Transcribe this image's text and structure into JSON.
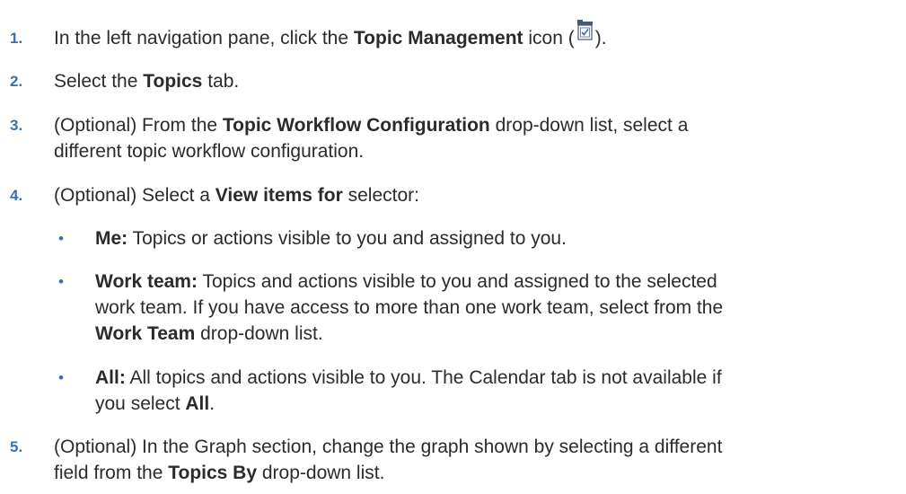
{
  "steps": [
    {
      "number": "1.",
      "before": "In the left navigation pane, click the ",
      "bold": "Topic Management",
      "after_bold": " icon (",
      "icon": "topic-management-icon",
      "end": ")."
    },
    {
      "number": "2.",
      "before": "Select the ",
      "bold": "Topics",
      "after": " tab."
    },
    {
      "number": "3.",
      "before": "(Optional) From the ",
      "bold": "Topic Workflow Configuration",
      "after_line1": " drop-down list, select a",
      "line2": "different topic workflow configuration."
    },
    {
      "number": "4.",
      "before": "(Optional) Select a ",
      "bold": "View items for",
      "after": " selector:",
      "bullets": [
        {
          "bold": "Me:",
          "text": " Topics or actions visible to you and assigned to you."
        },
        {
          "bold": "Work team:",
          "line1": " Topics and actions visible to you and assigned to the selected",
          "line2": "work team. If you have access to more than one work team, select from the",
          "line3_bold": "Work Team",
          "line3": " drop-down list."
        },
        {
          "bold": "All:",
          "line1": " All topics and actions visible to you. The Calendar tab is not available if",
          "line2": "you select ",
          "line2_bold": "All",
          "line2_end": "."
        }
      ]
    },
    {
      "number": "5.",
      "line1": "(Optional) In the Graph section, change the graph shown by selecting a different",
      "line2_before": "field from the ",
      "bold": "Topics By",
      "after": " drop-down list."
    }
  ],
  "colors": {
    "number_accent": "#3b6fb0",
    "text": "#2b2b2b",
    "icon_folder": "#4a5a6e"
  }
}
